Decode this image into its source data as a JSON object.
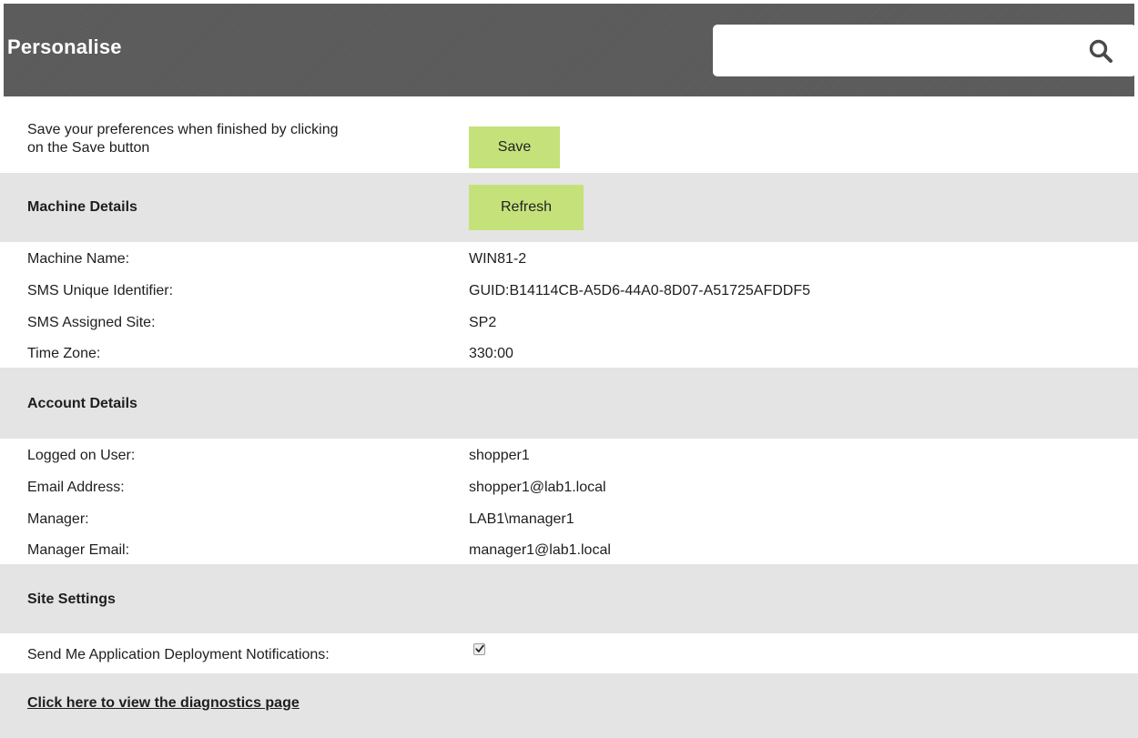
{
  "header": {
    "title": "Personalise",
    "search": {
      "value": "",
      "placeholder": ""
    }
  },
  "intro": {
    "line1": "Save your preferences when finished by clicking",
    "line2": "on the Save button",
    "save_label": "Save"
  },
  "machine": {
    "heading": "Machine Details",
    "refresh_label": "Refresh",
    "rows": [
      {
        "label": "Machine Name:",
        "value": "WIN81-2"
      },
      {
        "label": "SMS Unique Identifier:",
        "value": "GUID:B14114CB-A5D6-44A0-8D07-A51725AFDDF5"
      },
      {
        "label": "SMS Assigned Site:",
        "value": "SP2"
      },
      {
        "label": "Time Zone:",
        "value": "330:00"
      }
    ]
  },
  "account": {
    "heading": "Account Details",
    "rows": [
      {
        "label": "Logged on User:",
        "value": "shopper1"
      },
      {
        "label": "Email Address:",
        "value": "shopper1@lab1.local"
      },
      {
        "label": "Manager:",
        "value": "LAB1\\manager1"
      },
      {
        "label": "Manager Email:",
        "value": "manager1@lab1.local"
      }
    ]
  },
  "site": {
    "heading": "Site Settings",
    "notification_label": "Send Me Application Deployment Notifications:",
    "notification_checked": true
  },
  "footer": {
    "diagnostics_link": "Click here to view the diagnostics page"
  },
  "colors": {
    "header_bg": "#5a5a5a",
    "section_bg": "#e4e4e4",
    "button_bg": "#c5e27a"
  }
}
